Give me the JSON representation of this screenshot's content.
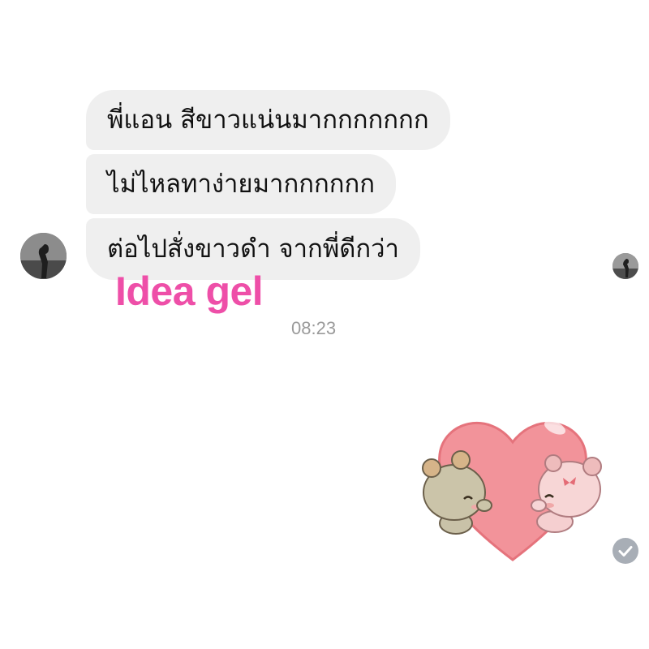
{
  "chat": {
    "messages": [
      {
        "text": "พี่แอน สีขาวแน่นมากกกกกกก"
      },
      {
        "text": "ไม่ไหลทาง่ายมากกกกกก"
      },
      {
        "text": "ต่อไปสั่งขาวดำ จากพี่ดีกว่า"
      }
    ],
    "timestamp": "08:23",
    "sticker": {
      "name": "heart-bears-sticker"
    },
    "read_receipt_icon": "checkmark-icon"
  },
  "watermark": {
    "text": "Idea gel",
    "color": "#ee4fa8"
  },
  "colors": {
    "bubble": "#efefef",
    "background": "#ffffff",
    "timestamp": "#9a9a9a",
    "heart": "#f2939a"
  }
}
